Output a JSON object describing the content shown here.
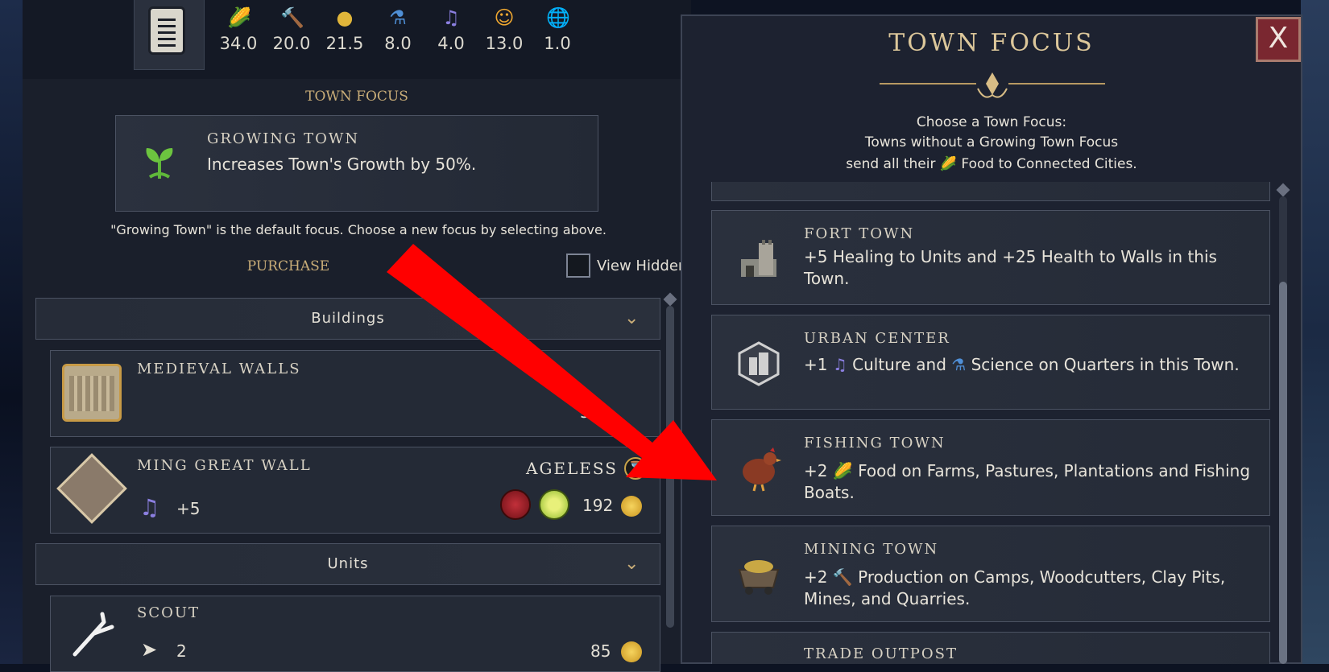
{
  "yields": [
    {
      "icon": "food-icon",
      "value": "34.0",
      "color": "#8fc93a",
      "glyph": "🌽"
    },
    {
      "icon": "production-icon",
      "value": "20.0",
      "color": "#b0a69a",
      "glyph": "🔨"
    },
    {
      "icon": "gold-icon",
      "value": "21.5",
      "color": "#e0b53a",
      "glyph": "●"
    },
    {
      "icon": "science-icon",
      "value": "8.0",
      "color": "#4f8fd6",
      "glyph": "⚗"
    },
    {
      "icon": "culture-icon",
      "value": "4.0",
      "color": "#8b7fe0",
      "glyph": "♫"
    },
    {
      "icon": "happiness-icon",
      "value": "13.0",
      "color": "#f0a830",
      "glyph": "☺"
    },
    {
      "icon": "influence-icon",
      "value": "1.0",
      "color": "#8fa6c4",
      "glyph": "🌐"
    }
  ],
  "left": {
    "town_focus_heading": "TOWN FOCUS",
    "current_focus": {
      "title": "GROWING TOWN",
      "desc": "Increases Town's Growth by 50%."
    },
    "default_note": "\"Growing Town\" is the default focus. Choose a new focus by selecting above.",
    "purchase_heading": "PURCHASE",
    "view_hidden": "View Hidden",
    "buildings_label": "Buildings",
    "units_label": "Units",
    "items": {
      "walls": {
        "title": "MEDIEVAL WALLS",
        "cost": "32"
      },
      "ming": {
        "title": "MING GREAT WALL",
        "ageless": "AGELESS",
        "culture": "+5",
        "cost": "192"
      },
      "scout": {
        "title": "SCOUT",
        "move": "2",
        "cost": "85"
      }
    }
  },
  "dialog": {
    "title": "TOWN FOCUS",
    "close": "X",
    "sub1": "Choose a Town Focus:",
    "sub2": "Towns without a Growing Town Focus",
    "sub3a": "send all their",
    "sub3b": "Food to Connected Cities.",
    "options": {
      "fort": {
        "title": "FORT TOWN",
        "desc": "+5 Healing to Units and +25 Health to Walls in this Town."
      },
      "urban": {
        "title": "URBAN CENTER",
        "d1": "+1",
        "d2": "Culture and",
        "d3": "Science on Quarters in this Town."
      },
      "fishing": {
        "title": "FISHING TOWN",
        "d1": "+2",
        "d2": "Food on Farms, Pastures, Plantations and Fishing Boats."
      },
      "mining": {
        "title": "MINING TOWN",
        "d1": "+2",
        "d2": "Production on Camps, Woodcutters, Clay Pits, Mines, and Quarries."
      },
      "trade": {
        "title": "TRADE OUTPOST"
      }
    }
  },
  "annotation_color": "#ff0000"
}
